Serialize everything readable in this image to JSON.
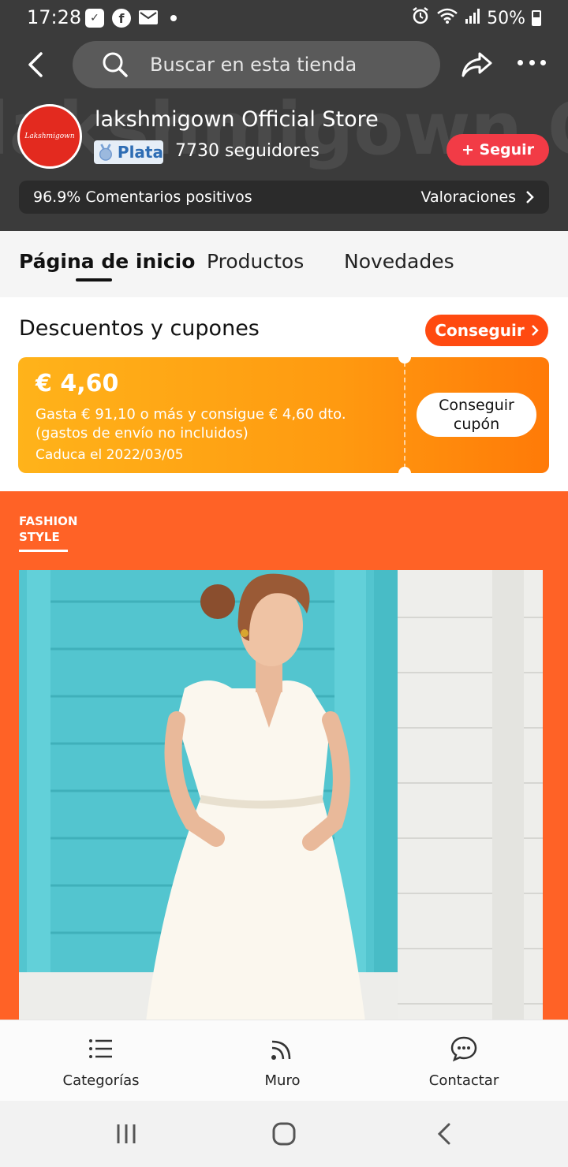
{
  "status_bar": {
    "time": "17:28",
    "battery": "50%",
    "left_icons": [
      "notification-icon",
      "facebook-icon",
      "mail-icon",
      "dot-icon"
    ],
    "right_icons": [
      "alarm-icon",
      "wifi-icon",
      "signal-icon",
      "battery-icon"
    ]
  },
  "nav": {
    "search_placeholder": "Buscar en esta tienda"
  },
  "store": {
    "logo_text": "Lakshmigown",
    "name": "lakshmigown Official Store",
    "badge": "Plata",
    "followers": "7730 seguidores",
    "follow_label": "+ Seguir",
    "positive": "96.9%  Comentarios positivos",
    "ratings_link": "Valoraciones"
  },
  "tabs": [
    {
      "label": "Página de inicio",
      "active": true
    },
    {
      "label": "Productos",
      "active": false
    },
    {
      "label": "Novedades",
      "active": false
    }
  ],
  "coupons": {
    "title": "Descuentos y cupones",
    "get_label": "Conseguir",
    "card": {
      "amount": "€ 4,60",
      "line1": "Gasta € 91,10 o más y consigue € 4,60 dto.",
      "line2": "(gastos de envío no incluidos)",
      "expiry": "Caduca el 2022/03/05",
      "button_line1": "Conseguir",
      "button_line2": "cupón"
    }
  },
  "banner": {
    "label_line1": "FASHION",
    "label_line2": "STYLE"
  },
  "bottom_bar": [
    {
      "label": "Categorías",
      "icon": "list-icon"
    },
    {
      "label": "Muro",
      "icon": "feed-icon"
    },
    {
      "label": "Contactar",
      "icon": "chat-icon"
    }
  ],
  "colors": {
    "header_bg": "#3b3b3b",
    "follow": "#f23b46",
    "accent": "#ff4a10",
    "banner": "#ff6226",
    "coupon_start": "#ffb31a",
    "coupon_end": "#ff7a08"
  }
}
